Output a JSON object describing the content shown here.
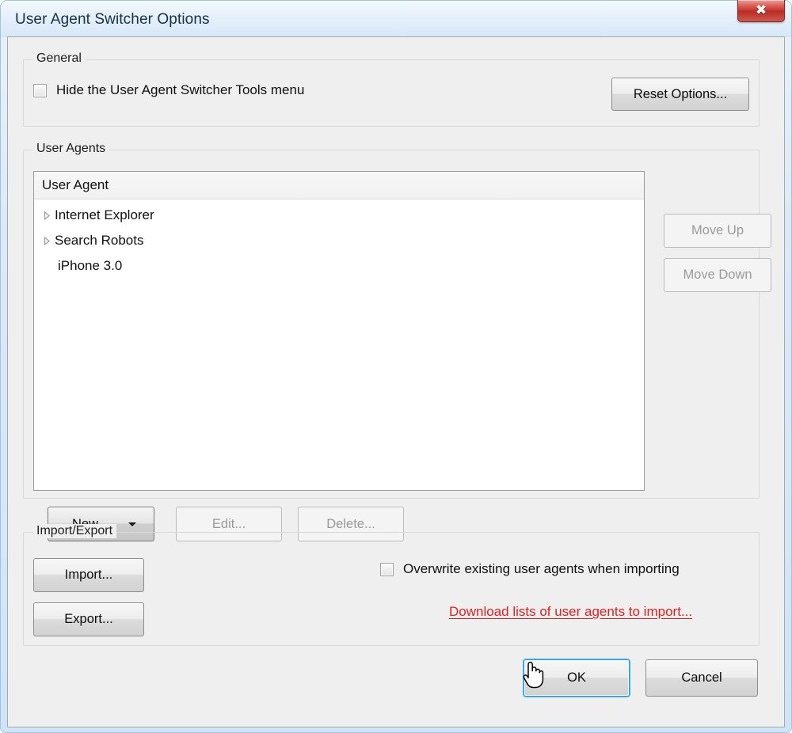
{
  "window": {
    "title": "User Agent Switcher Options",
    "close_label": "✖",
    "close_icon": "close-icon"
  },
  "general": {
    "group_title": "General",
    "hide_menu_label": "Hide the User Agent Switcher Tools menu",
    "hide_menu_checked": false,
    "reset_button": "Reset Options..."
  },
  "user_agents": {
    "group_title": "User Agents",
    "column_header": "User Agent",
    "items": [
      {
        "label": "Internet Explorer",
        "expandable": true,
        "expanded": false
      },
      {
        "label": "Search Robots",
        "expandable": true,
        "expanded": false
      },
      {
        "label": "iPhone 3.0",
        "expandable": false,
        "expanded": false
      }
    ],
    "move_up": "Move Up",
    "move_down": "Move Down",
    "new_button": "New",
    "edit_button": "Edit...",
    "delete_button": "Delete..."
  },
  "import_export": {
    "group_title": "Import/Export",
    "import_button": "Import...",
    "export_button": "Export...",
    "overwrite_label": "Overwrite existing user agents when importing",
    "overwrite_checked": false,
    "download_link": "Download lists of user agents to import..."
  },
  "dialog_buttons": {
    "ok": "OK",
    "cancel": "Cancel"
  },
  "colors": {
    "link_red": "#e02020",
    "focus_blue": "#44b4f0",
    "close_red": "#c3352c",
    "dialog_bg": "#efefef"
  }
}
